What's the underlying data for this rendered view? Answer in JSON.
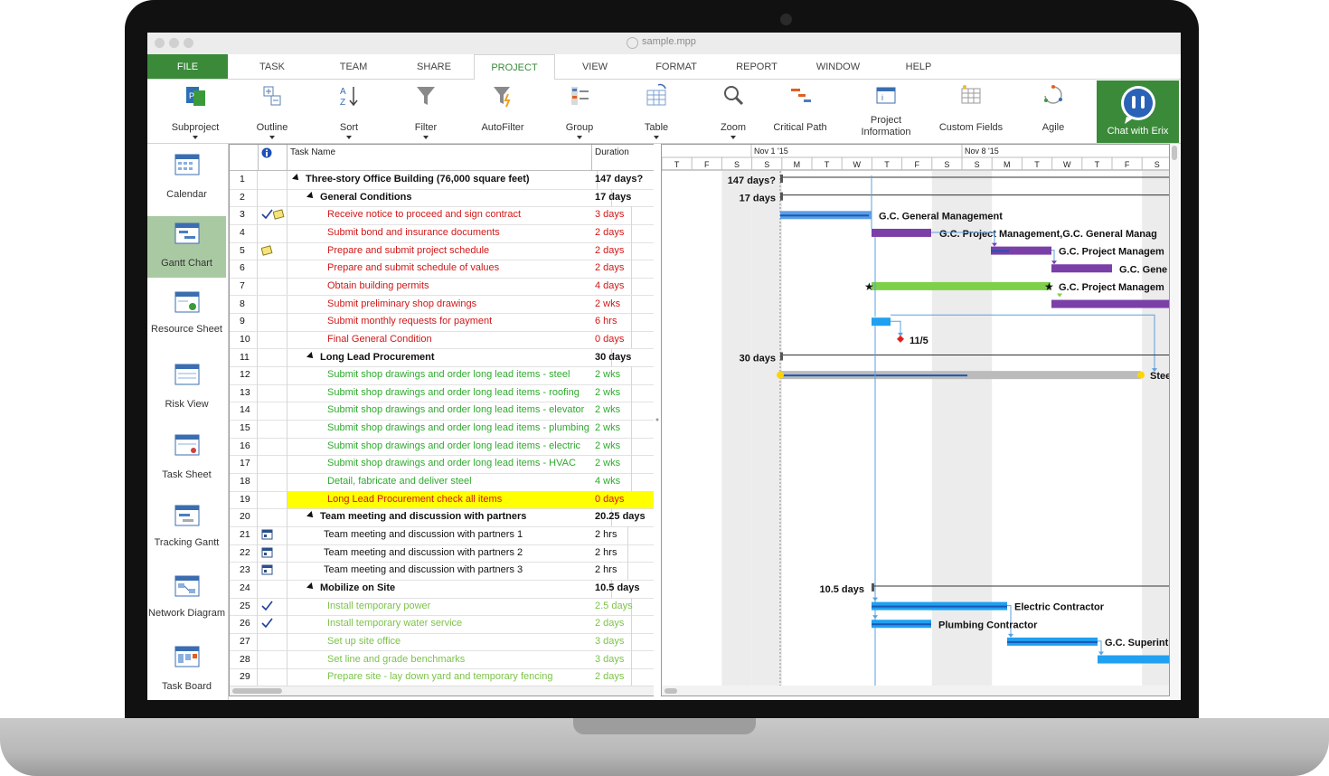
{
  "window": {
    "title": "sample.mpp"
  },
  "menu": [
    {
      "label": "FILE"
    },
    {
      "label": "TASK"
    },
    {
      "label": "TEAM"
    },
    {
      "label": "SHARE"
    },
    {
      "label": "PROJECT"
    },
    {
      "label": "VIEW"
    },
    {
      "label": "FORMAT"
    },
    {
      "label": "REPORT"
    },
    {
      "label": "WINDOW"
    },
    {
      "label": "HELP"
    }
  ],
  "ribbon": {
    "subproject": "Subproject",
    "outline": "Outline",
    "sort": "Sort",
    "filter": "Filter",
    "autofilter": "AutoFilter",
    "group": "Group",
    "table": "Table",
    "zoom": "Zoom",
    "critical_path": "Critical Path",
    "project_information": "Project Information",
    "custom_fields": "Custom Fields",
    "agile": "Agile",
    "chat": "Chat with Erix"
  },
  "views": [
    {
      "label": "Calendar"
    },
    {
      "label": "Gantt Chart"
    },
    {
      "label": "Resource Sheet"
    },
    {
      "label": "Risk View"
    },
    {
      "label": "Task Sheet"
    },
    {
      "label": "Tracking Gantt"
    },
    {
      "label": "Network Diagram"
    },
    {
      "label": "Task Board"
    }
  ],
  "grid": {
    "col_task_name": "Task Name",
    "col_duration": "Duration",
    "rows": [
      {
        "id": "1",
        "name": "Three-story Office Building (76,000 square feet)",
        "duration": "147 days?"
      },
      {
        "id": "2",
        "name": "General Conditions",
        "duration": "17 days"
      },
      {
        "id": "3",
        "name": "Receive notice to proceed and sign contract",
        "duration": "3 days"
      },
      {
        "id": "4",
        "name": "Submit bond and insurance documents",
        "duration": "2 days"
      },
      {
        "id": "5",
        "name": "Prepare and submit project schedule",
        "duration": "2 days"
      },
      {
        "id": "6",
        "name": "Prepare and submit schedule of values",
        "duration": "2 days"
      },
      {
        "id": "7",
        "name": "Obtain building permits",
        "duration": "4 days"
      },
      {
        "id": "8",
        "name": "Submit preliminary shop drawings",
        "duration": "2 wks"
      },
      {
        "id": "9",
        "name": "Submit monthly requests for payment",
        "duration": "6 hrs"
      },
      {
        "id": "10",
        "name": "Final General Condition",
        "duration": "0 days"
      },
      {
        "id": "11",
        "name": "Long Lead Procurement",
        "duration": "30 days"
      },
      {
        "id": "12",
        "name": "Submit shop drawings and order long lead items - steel",
        "duration": "2 wks"
      },
      {
        "id": "13",
        "name": "Submit shop drawings and order long lead items - roofing",
        "duration": "2 wks"
      },
      {
        "id": "14",
        "name": "Submit shop drawings and order long lead items - elevator",
        "duration": "2 wks"
      },
      {
        "id": "15",
        "name": "Submit shop drawings and order long lead items - plumbing",
        "duration": "2 wks"
      },
      {
        "id": "16",
        "name": "Submit shop drawings and order long lead items - electric",
        "duration": "2 wks"
      },
      {
        "id": "17",
        "name": "Submit shop drawings and order long lead items - HVAC",
        "duration": "2 wks"
      },
      {
        "id": "18",
        "name": "Detail, fabricate and deliver steel",
        "duration": "4 wks"
      },
      {
        "id": "19",
        "name": "Long Lead Procurement check all items",
        "duration": "0 days"
      },
      {
        "id": "20",
        "name": "Team meeting and discussion with partners",
        "duration": "20.25 days"
      },
      {
        "id": "21",
        "name": "Team meeting and discussion with partners 1",
        "duration": "2 hrs"
      },
      {
        "id": "22",
        "name": "Team meeting and discussion with partners 2",
        "duration": "2 hrs"
      },
      {
        "id": "23",
        "name": "Team meeting and discussion with partners 3",
        "duration": "2 hrs"
      },
      {
        "id": "24",
        "name": "Mobilize on Site",
        "duration": "10.5 days"
      },
      {
        "id": "25",
        "name": "Install temporary power",
        "duration": "2.5 days"
      },
      {
        "id": "26",
        "name": "Install temporary water service",
        "duration": "2 days"
      },
      {
        "id": "27",
        "name": "Set up site office",
        "duration": "3 days"
      },
      {
        "id": "28",
        "name": "Set line and grade benchmarks",
        "duration": "3 days"
      },
      {
        "id": "29",
        "name": "Prepare site - lay down yard and temporary fencing",
        "duration": "2 days"
      }
    ]
  },
  "timescale": {
    "week1": "Nov 1 '15",
    "week2": "Nov 8 '15",
    "days": [
      "T",
      "F",
      "S",
      "S",
      "M",
      "T",
      "W",
      "T",
      "F",
      "S",
      "S",
      "M",
      "T",
      "W",
      "T",
      "F",
      "S"
    ]
  },
  "gantt_labels": {
    "r1": "147 days?",
    "r2": "17 days",
    "r3": "G.C. General Management",
    "r4": "G.C. Project Management,G.C. General Manag",
    "r5": "G.C. Project Managem",
    "r6": "G.C. Gene",
    "r7": "G.C. Project Managem",
    "r10": "11/5",
    "r11": "30 days",
    "r12": "Stee",
    "r24": "10.5 days",
    "r25": "Electric Contractor",
    "r26": "Plumbing Contractor",
    "r27": "G.C. Superint"
  }
}
